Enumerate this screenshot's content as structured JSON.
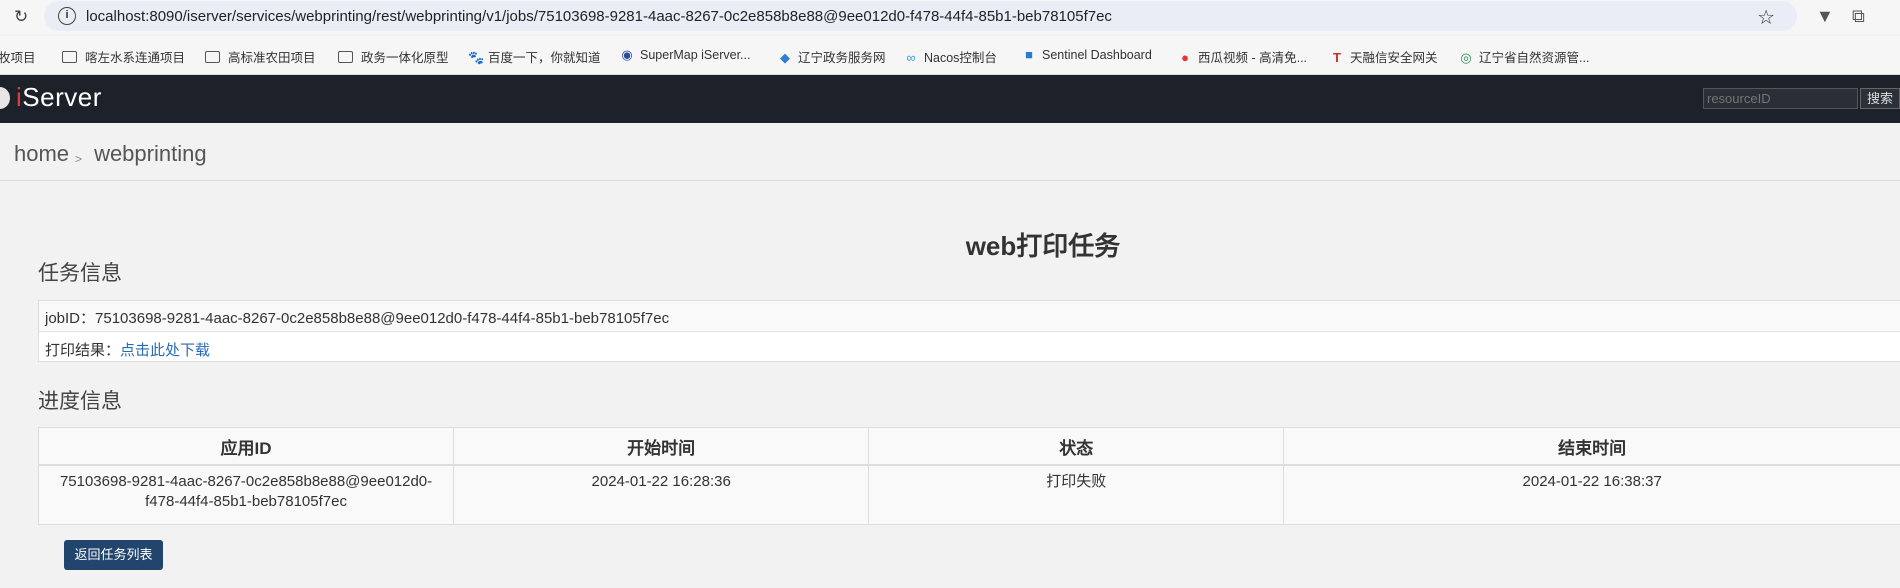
{
  "browser": {
    "url": "localhost:8090/iserver/services/webprinting/rest/webprinting/v1/jobs/75103698-9281-4aac-8267-0c2e858b8e88@9ee012d0-f478-44f4-85b1-beb78105f7ec",
    "bookmarks": [
      {
        "label": "牧项目",
        "icon": "folder-icon"
      },
      {
        "label": "喀左水系连通项目",
        "icon": "folder-icon"
      },
      {
        "label": "高标准农田项目",
        "icon": "folder-icon"
      },
      {
        "label": "政务一体化原型",
        "icon": "folder-icon"
      },
      {
        "label": "百度一下，你就知道",
        "icon": "baidu-icon"
      },
      {
        "label": "SuperMap iServer...",
        "icon": "supermap-icon"
      },
      {
        "label": "辽宁政务服务网",
        "icon": "shield-icon"
      },
      {
        "label": "Nacos控制台",
        "icon": "nacos-icon"
      },
      {
        "label": "Sentinel Dashboard",
        "icon": "sentinel-icon"
      },
      {
        "label": "西瓜视频 - 高清免...",
        "icon": "xigua-icon"
      },
      {
        "label": "天融信安全网关",
        "icon": "topsec-icon"
      },
      {
        "label": "辽宁省自然资源管...",
        "icon": "emblem-icon"
      }
    ]
  },
  "header": {
    "logo_i": "i",
    "logo_rest": "Server",
    "search_placeholder": "resourceID",
    "search_button": "搜索"
  },
  "breadcrumb": {
    "home": "home",
    "sep": ">",
    "current": "webprinting"
  },
  "page": {
    "title": "web打印任务",
    "task_section": "任务信息",
    "job_id_label": "jobID：",
    "job_id": "75103698-9281-4aac-8267-0c2e858b8e88@9ee012d0-f478-44f4-85b1-beb78105f7ec",
    "result_label": "打印结果：",
    "result_link": "点击此处下载",
    "progress_section": "进度信息",
    "columns": [
      "应用ID",
      "开始时间",
      "状态",
      "结束时间"
    ],
    "row": {
      "app_id": "75103698-9281-4aac-8267-0c2e858b8e88@9ee012d0-f478-44f4-85b1-beb78105f7ec",
      "start_time": "2024-01-22 16:28:36",
      "status": "打印失败",
      "end_time": "2024-01-22 16:38:37"
    },
    "back_button": "返回任务列表"
  }
}
